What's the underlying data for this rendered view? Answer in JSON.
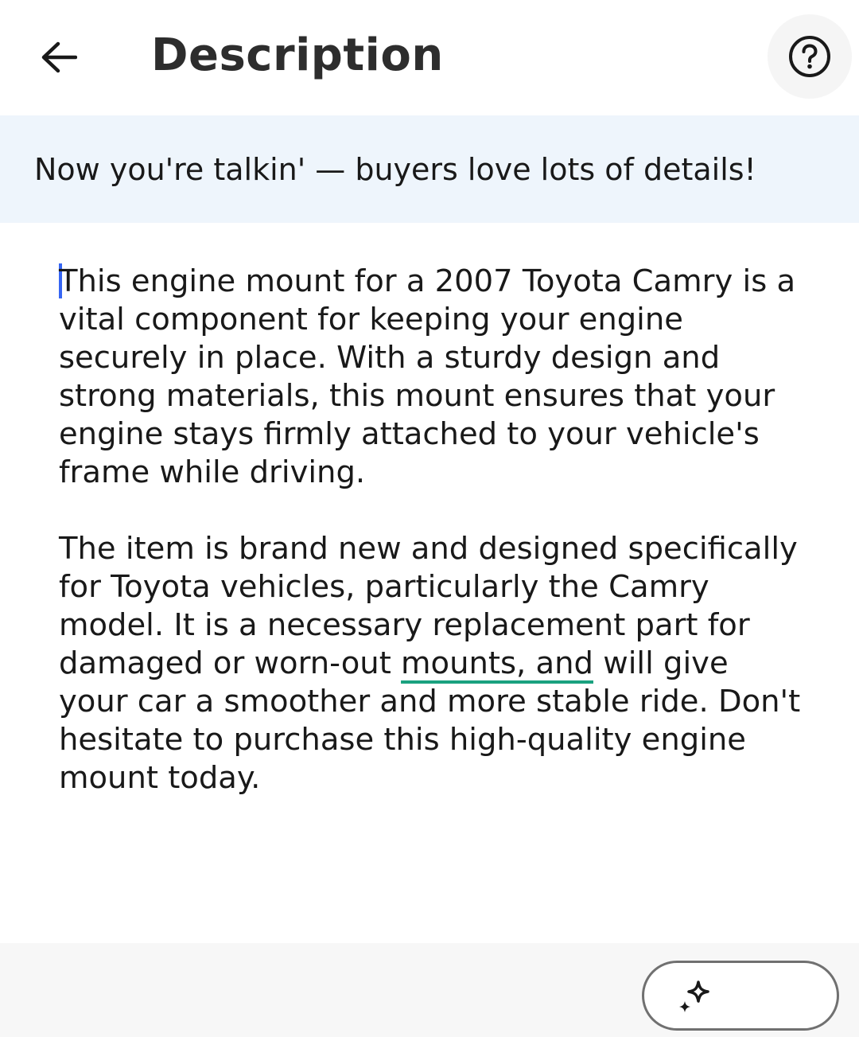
{
  "header": {
    "title": "Description",
    "back_icon": "arrow-left-icon",
    "help_icon": "question-circle-icon"
  },
  "banner": {
    "message": "Now you're talkin' — buyers love lots of details!"
  },
  "editor": {
    "paragraph_1": "This engine mount for a 2007 Toyota Camry is a vital component for keeping your engine securely in place. With a sturdy design and strong materials, this mount ensures that your engine stays firmly attached to your vehicle's frame while driving.",
    "paragraph_2_before": "The item is brand new and designed specifically for Toyota vehicles, particularly the Camry model. It is a necessary replacement part for damaged or worn-out ",
    "paragraph_2_flagged": "mounts, and",
    "paragraph_2_after": " will give your car a smoother and more stable ride. Don't hesitate to purchase this high-quality engine mount today."
  },
  "footer": {
    "ai_icon": "sparkle-icon"
  },
  "colors": {
    "banner_bg": "#eef5fc",
    "caret": "#3665f3",
    "spellcheck_underline": "#1aa17f"
  }
}
